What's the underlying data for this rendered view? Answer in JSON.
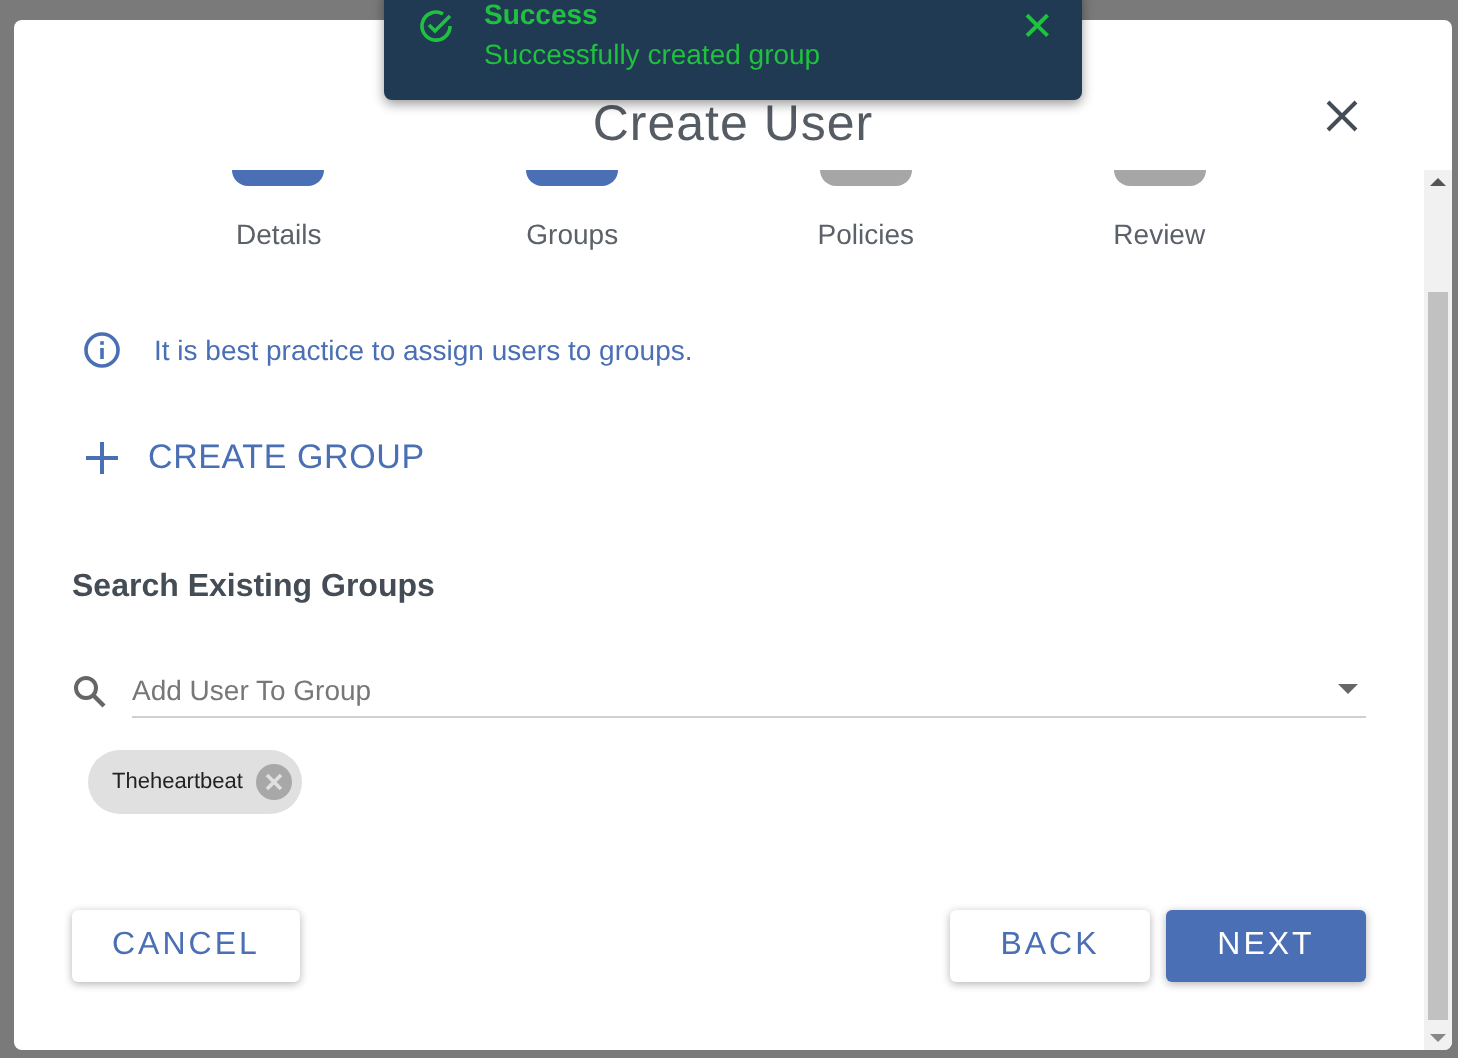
{
  "toast": {
    "title": "Success",
    "message": "Successfully created group",
    "close": "✕"
  },
  "dialog": {
    "title": "Create User"
  },
  "steps": [
    {
      "label": "Details",
      "completed": true
    },
    {
      "label": "Groups",
      "completed": true
    },
    {
      "label": "Policies",
      "completed": false
    },
    {
      "label": "Review",
      "completed": false
    }
  ],
  "info": "It is best practice to assign users to groups.",
  "create_group": "CREATE GROUP",
  "section_title": "Search Existing Groups",
  "search": {
    "placeholder": "Add User To Group"
  },
  "chips": [
    {
      "label": "Theheartbeat"
    }
  ],
  "buttons": {
    "cancel": "CANCEL",
    "back": "BACK",
    "next": "NEXT"
  }
}
